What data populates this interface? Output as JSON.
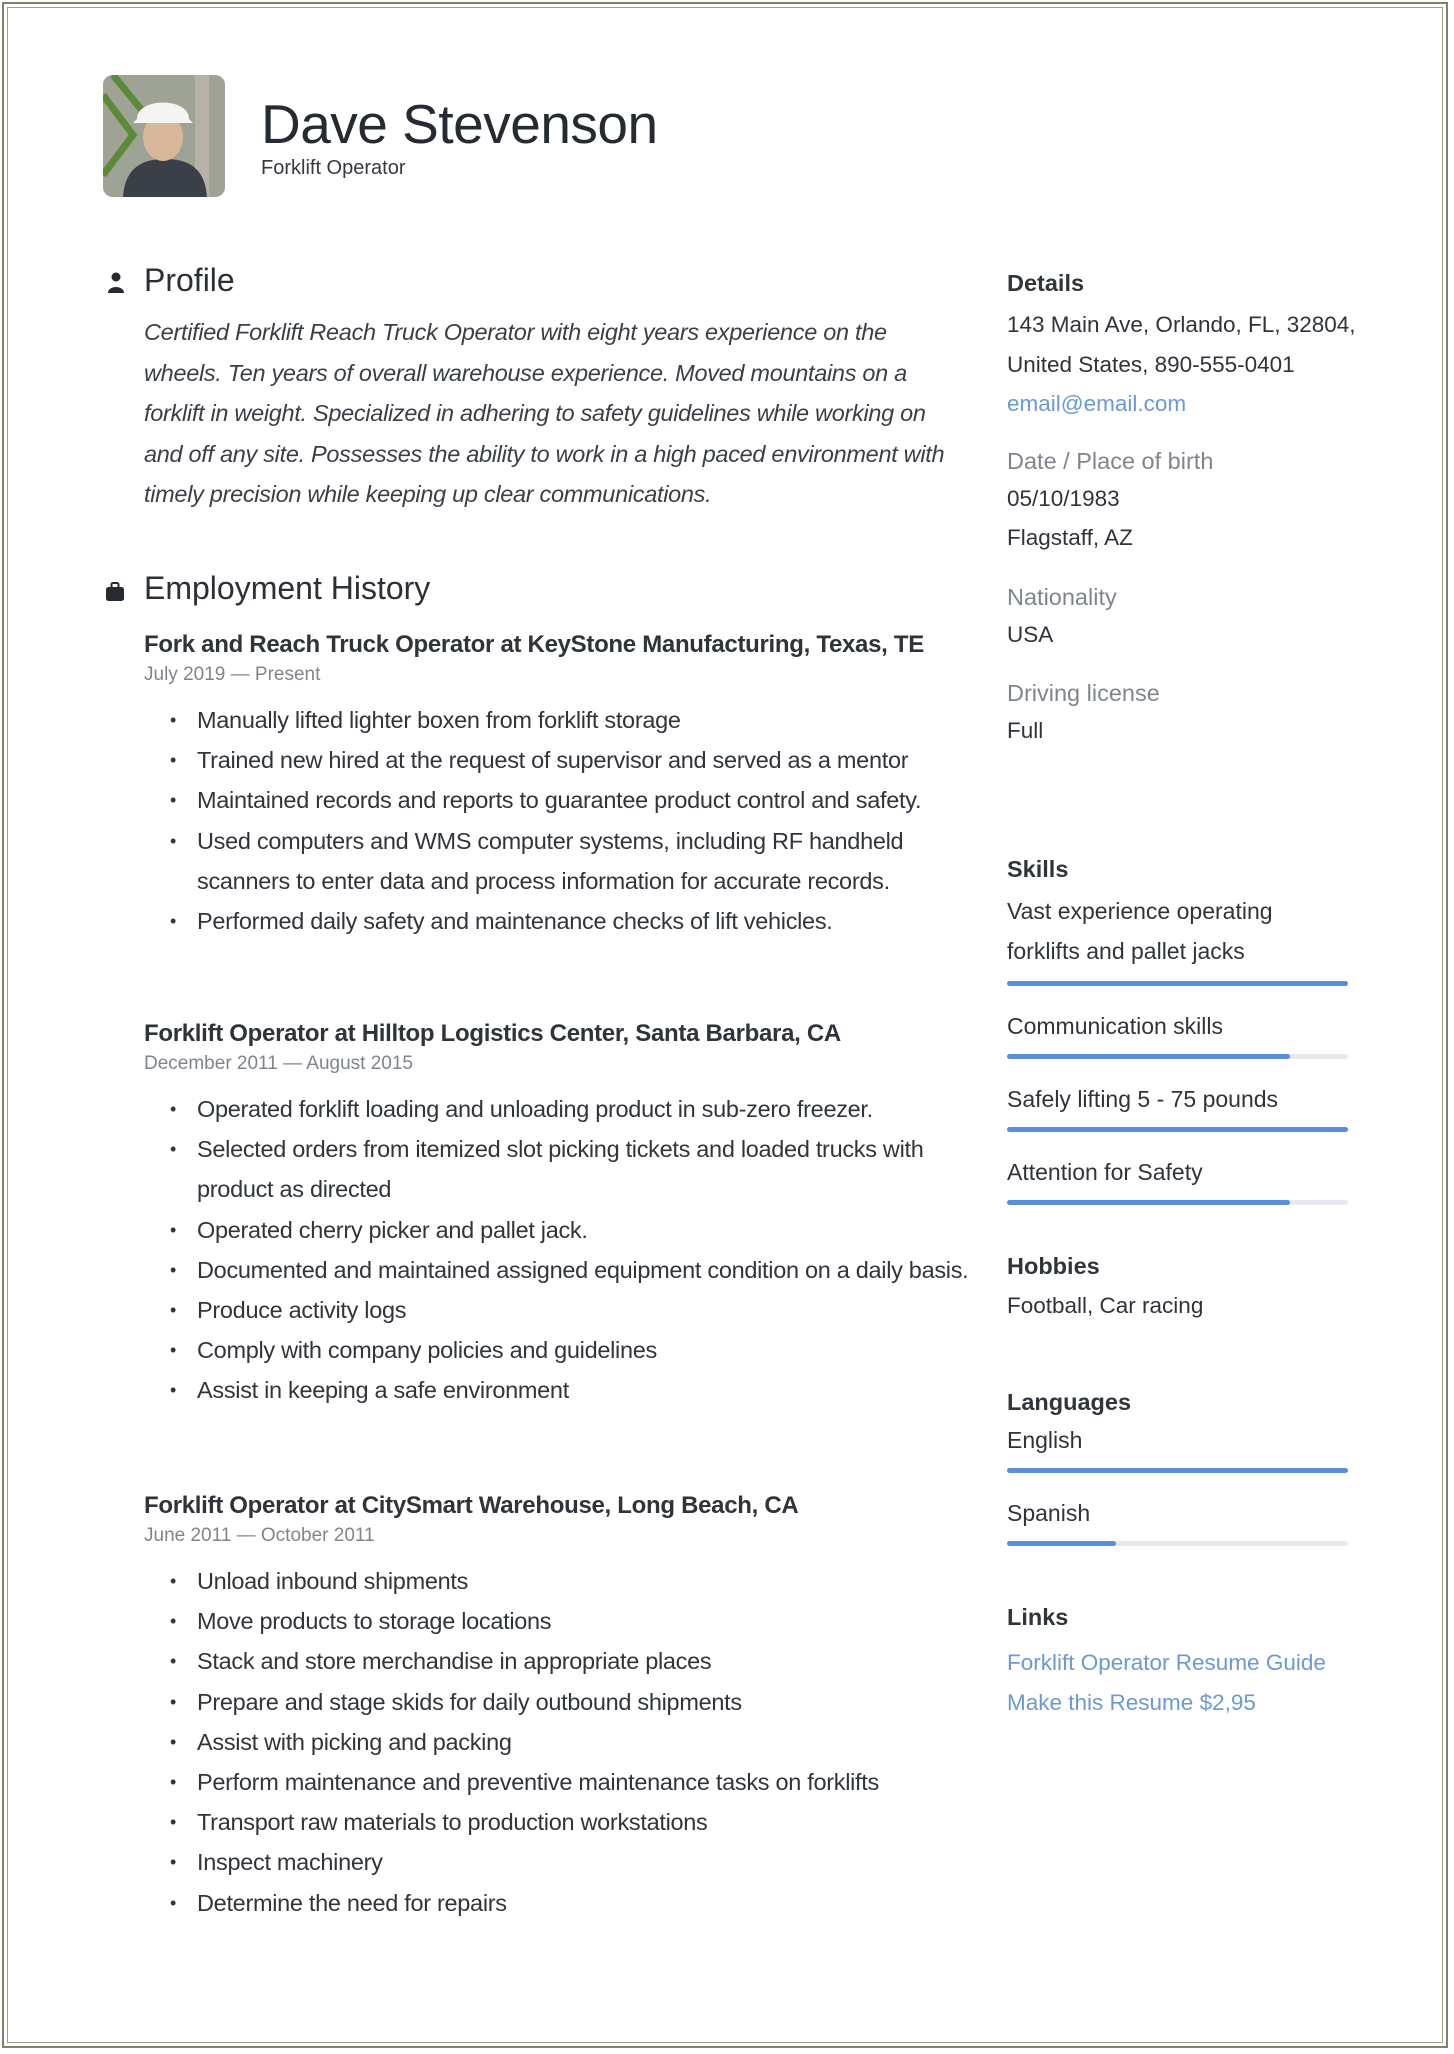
{
  "header": {
    "name": "Dave Stevenson",
    "job_title": "Forklift Operator",
    "photo_alt": "profile photo of man in white hard hat"
  },
  "profile": {
    "heading": "Profile",
    "icon": "person-icon",
    "text": "Certified Forklift Reach Truck Operator with eight years experience on the wheels. Ten years of overall warehouse experience. Moved mountains on a forklift in weight. Specialized in adhering to safety guidelines while working on and off any site. Possesses the ability to work in a high paced environment with timely precision while keeping up clear communications."
  },
  "employment": {
    "heading": "Employment History",
    "icon": "briefcase-icon",
    "jobs": [
      {
        "title": "Fork and Reach Truck Operator at  KeyStone Manufacturing, Texas, TE",
        "dates": "July 2019 — Present",
        "bullets": [
          "Manually lifted lighter boxen from forklift storage",
          "Trained new hired at the request of supervisor and served as a mentor",
          "Maintained records and reports to guarantee product control and safety.",
          "Used computers and WMS computer systems, including RF handheld scanners to enter data and process information for accurate records.",
          "Performed daily safety and maintenance checks of lift vehicles."
        ]
      },
      {
        "title": "Forklift Operator at  Hilltop Logistics Center, Santa Barbara, CA",
        "dates": "December 2011 — August 2015",
        "bullets": [
          "Operated forklift loading and unloading product in sub-zero freezer.",
          "Selected orders from itemized slot picking tickets and loaded trucks with product as directed",
          "Operated cherry picker and pallet jack.",
          "Documented and maintained assigned equipment condition on a daily basis.",
          "Produce activity logs",
          "Comply with company policies and guidelines",
          "Assist in keeping a safe environment"
        ]
      },
      {
        "title": "Forklift Operator at  CitySmart Warehouse, Long Beach, CA",
        "dates": "June 2011 — October 2011",
        "bullets": [
          "Unload inbound shipments",
          "Move products to storage locations",
          "Stack and store merchandise in appropriate places",
          "Prepare and stage skids for daily outbound shipments",
          "Assist with picking and packing",
          "Perform maintenance and preventive maintenance tasks on forklifts",
          "Transport raw materials to production workstations",
          "Inspect machinery",
          "Determine the need for repairs"
        ]
      }
    ]
  },
  "details": {
    "heading": "Details",
    "address_line1": "143 Main Ave, Orlando, FL, 32804,",
    "address_line2": "United States, 890-555-0401",
    "email": "email@email.com",
    "birth_label": "Date / Place of birth",
    "birth_date": "05/10/1983",
    "birth_place": "Flagstaff, AZ",
    "nationality_label": "Nationality",
    "nationality": "USA",
    "license_label": "Driving license",
    "license": "Full"
  },
  "skills": {
    "heading": "Skills",
    "items": [
      {
        "name": "Vast experience operating forklifts and pallet jacks",
        "level": 1.0
      },
      {
        "name": "Communication skills",
        "level": 0.83
      },
      {
        "name": "Safely lifting 5 - 75 pounds",
        "level": 1.0
      },
      {
        "name": "Attention for Safety",
        "level": 0.83
      }
    ]
  },
  "hobbies": {
    "heading": "Hobbies",
    "text": "Football, Car racing"
  },
  "languages": {
    "heading": "Languages",
    "items": [
      {
        "name": "English",
        "level": 1.0
      },
      {
        "name": "Spanish",
        "level": 0.32
      }
    ]
  },
  "links": {
    "heading": "Links",
    "items": [
      "Forklift Operator Resume Guide",
      "Make this Resume $2,95"
    ]
  },
  "colors": {
    "accent": "#5b8ed6",
    "link": "#6a9ad3",
    "bar_track": "#e6e9ee",
    "muted": "#80868e",
    "frame": "#7d8270"
  }
}
